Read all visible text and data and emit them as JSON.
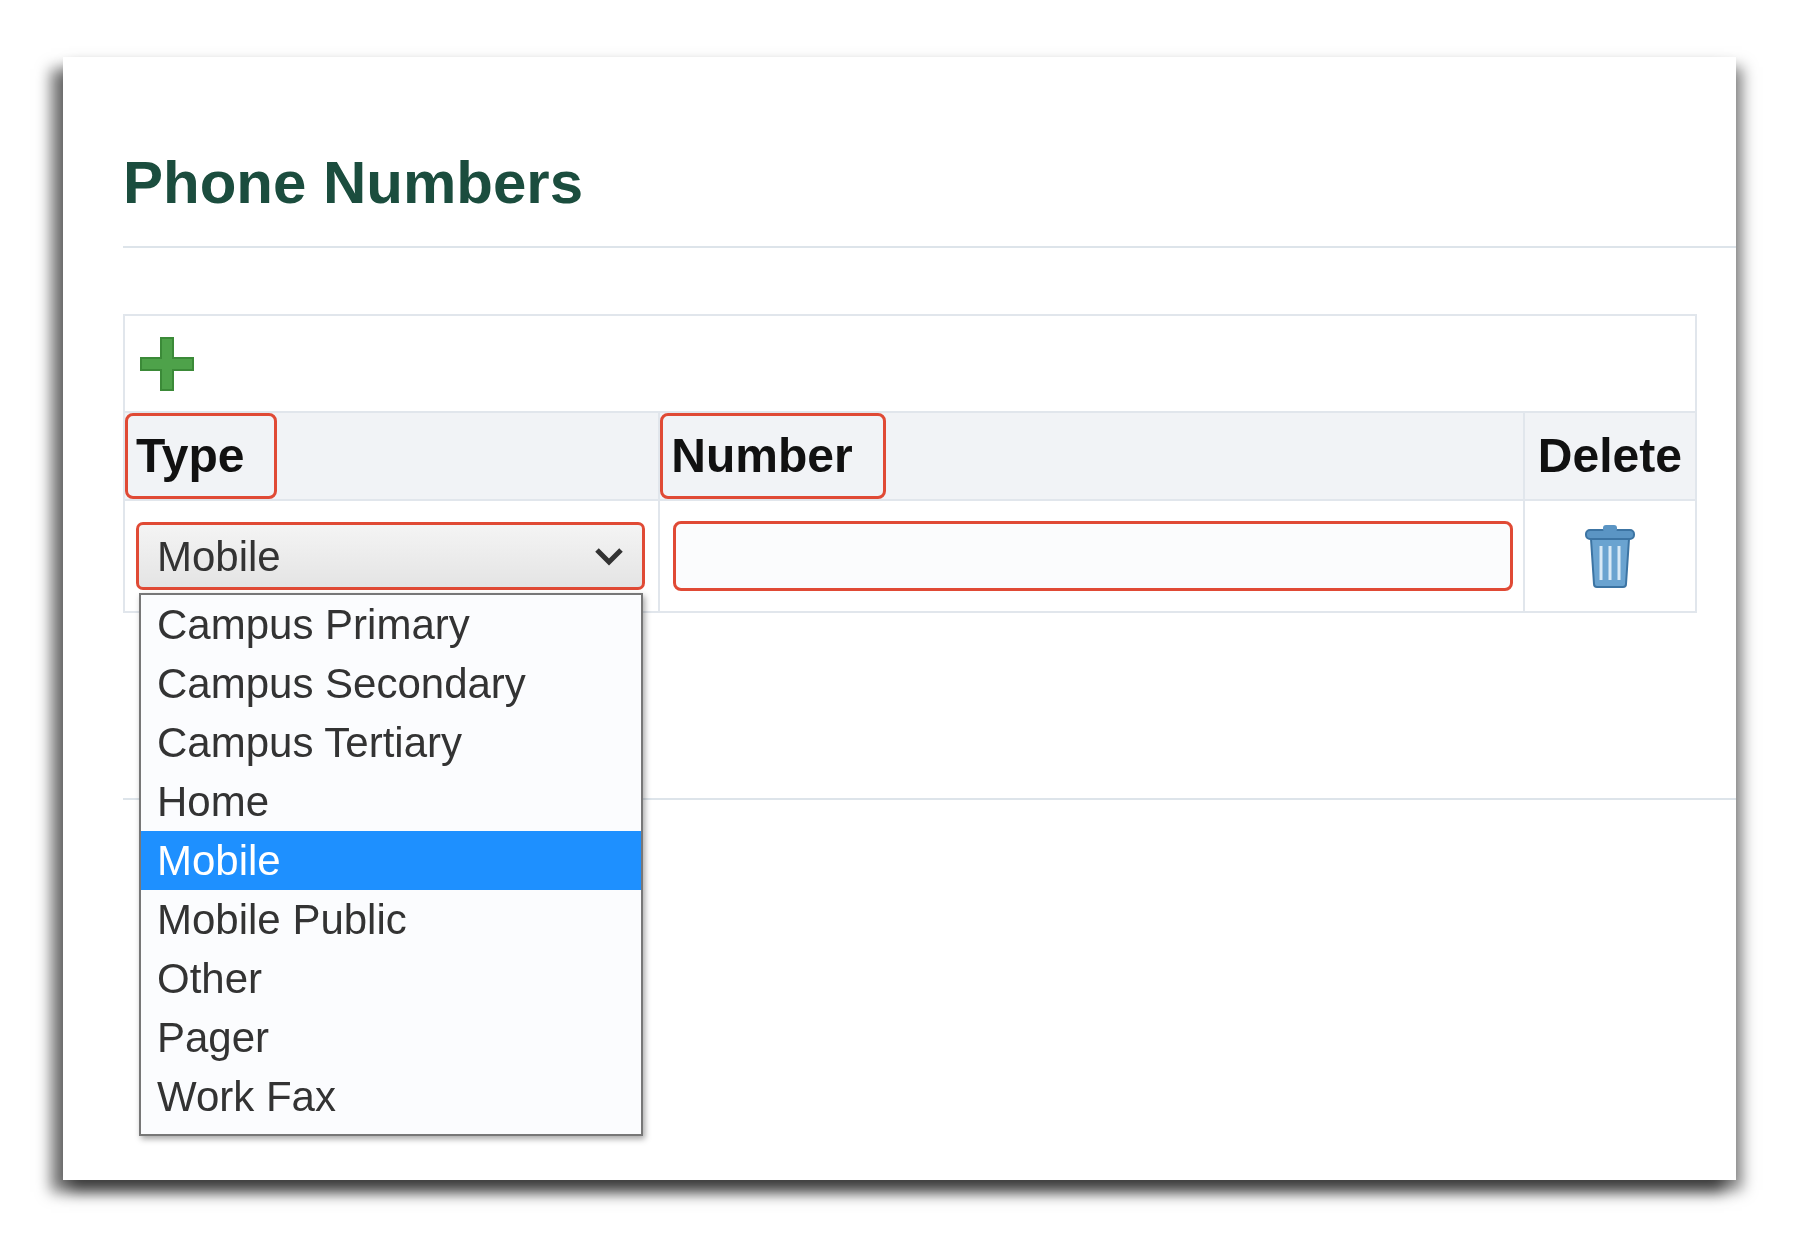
{
  "title": "Phone Numbers",
  "table": {
    "columns": [
      {
        "label": "Type",
        "highlighted": true
      },
      {
        "label": "Number",
        "highlighted": true
      },
      {
        "label": "Delete",
        "highlighted": false
      }
    ],
    "rows": [
      {
        "type_select": {
          "value": "Mobile",
          "highlighted": true,
          "expanded": true,
          "options": [
            {
              "label": "Campus Primary",
              "selected": false
            },
            {
              "label": "Campus Secondary",
              "selected": false
            },
            {
              "label": "Campus Tertiary",
              "selected": false
            },
            {
              "label": "Home",
              "selected": false
            },
            {
              "label": "Mobile",
              "selected": true
            },
            {
              "label": "Mobile Public",
              "selected": false
            },
            {
              "label": "Other",
              "selected": false
            },
            {
              "label": "Pager",
              "selected": false
            },
            {
              "label": "Work Fax",
              "selected": false
            }
          ]
        },
        "number_field": {
          "highlighted": true
        }
      }
    ]
  }
}
